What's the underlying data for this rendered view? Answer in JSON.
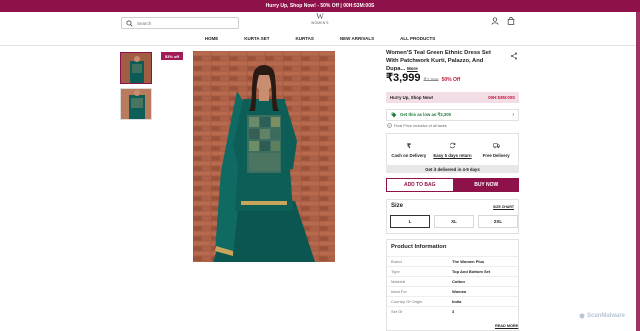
{
  "promo_bar": {
    "text": "Hurry Up, Shop Now! - 50% Off",
    "timer": "00H:53M:00S"
  },
  "header": {
    "search_placeholder": "Search",
    "logo_text": "WOMEN'S",
    "icons": [
      "user-icon",
      "bag-icon"
    ]
  },
  "nav": {
    "items": [
      "HOME",
      "KURTA SET",
      "KURTAS",
      "NEW ARRIVALS",
      "ALL PRODUCTS"
    ]
  },
  "gallery": {
    "badge": "53% off"
  },
  "product": {
    "title": "Women'S Teal Green Ethnic Dress Set With Patchwork Kurti, Palazzo, And Dupa...",
    "more": "More",
    "price": "₹3,999",
    "mrp": "₹7,999",
    "discount": "50% Off",
    "hurry_text": "Hurry Up, Shop Now!",
    "hurry_timer": "00H:53M:00S",
    "offer_text": "Get this as low as ₹3,300",
    "inclusive": "Final Price inclusive of all taxes",
    "features": [
      "Cash on Delivery",
      "Easy 5 days return",
      "Free Delivery"
    ],
    "delivery": "Get it delivered in 4-9 days",
    "add_to_bag": "ADD TO BAG",
    "buy_now": "BUY NOW"
  },
  "size": {
    "heading": "Size",
    "chart_link": "SIZE CHART",
    "options": [
      "L",
      "XL",
      "2XL"
    ],
    "selected": "L"
  },
  "info": {
    "heading": "Product Information",
    "rows": [
      {
        "k": "Brand",
        "v": "The Women Plus"
      },
      {
        "k": "Type",
        "v": "Top And Bottom Set"
      },
      {
        "k": "Material",
        "v": "Cotton"
      },
      {
        "k": "Ideal For",
        "v": "Women"
      },
      {
        "k": "Country Of Origin",
        "v": "India"
      },
      {
        "k": "Set Of",
        "v": "3"
      }
    ],
    "read_more": "READ MORE"
  },
  "watermark": "ScanMalware",
  "colors": {
    "brand": "#8e1149",
    "discount": "#c0143c",
    "offer": "#1c7a3a"
  }
}
